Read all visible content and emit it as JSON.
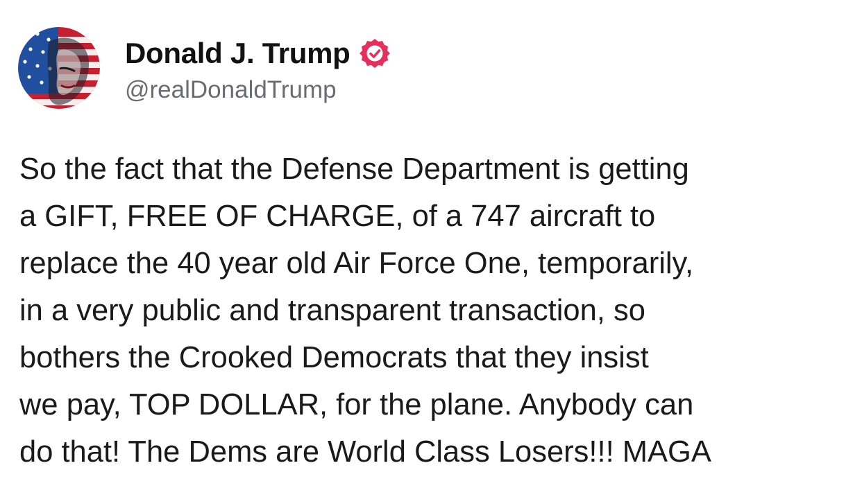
{
  "post": {
    "author": {
      "display_name": "Donald J. Trump",
      "handle": "@realDonaldTrump",
      "verified": true,
      "verified_badge_color": "#e5305d",
      "avatar_icon": "flag-portrait-avatar"
    },
    "text_lines": [
      "So the fact that the Defense Department is getting",
      "a GIFT, FREE OF CHARGE, of a 747 aircraft to",
      "replace the 40 year old Air Force One, temporarily,",
      "in a very public and transparent transaction, so",
      "bothers the Crooked Democrats that they insist",
      "we pay, TOP DOLLAR, for the plane. Anybody can",
      "do that! The Dems are World Class Losers!!! MAGA"
    ]
  }
}
